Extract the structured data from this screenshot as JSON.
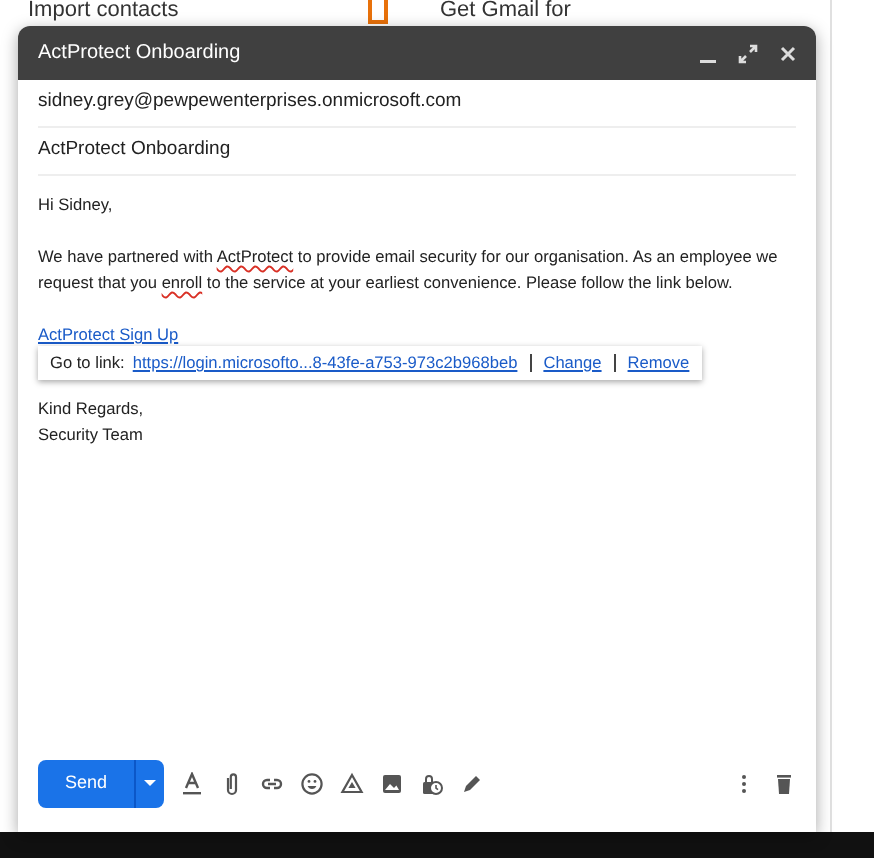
{
  "background_cards": [
    "Import contacts",
    "Get Gmail for"
  ],
  "compose": {
    "title": "ActProtect Onboarding",
    "to": "sidney.grey@pewpewenterprises.onmicrosoft.com",
    "subject": "ActProtect Onboarding",
    "greeting": "Hi Sidney,",
    "paragraph": [
      {
        "text": "We have partnered with ",
        "misspelled": false
      },
      {
        "text": "ActProtect",
        "misspelled": true
      },
      {
        "text": " to provide email security for our organisation. As an employee we request that you ",
        "misspelled": false
      },
      {
        "text": "enroll",
        "misspelled": true
      },
      {
        "text": " to the service at your earliest convenience. Please follow the link below.",
        "misspelled": false
      }
    ],
    "link_text": "ActProtect Sign Up",
    "link_popup": {
      "label": "Go to link:",
      "url": "https://login.microsofto...8-43fe-a753-973c2b968beb",
      "actions": [
        "Change",
        "Remove"
      ]
    },
    "closing": [
      "Kind Regards,",
      "Security Team"
    ],
    "send_label": "Send"
  }
}
